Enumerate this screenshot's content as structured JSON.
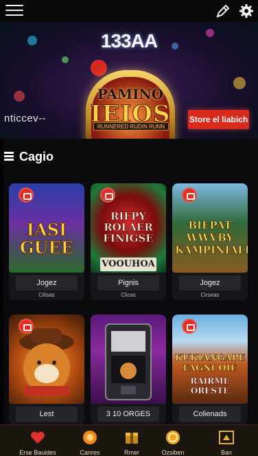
{
  "app": {
    "icons": {
      "menu": "hamburger-icon",
      "edit": "pencil-icon",
      "settings": "gear-icon"
    }
  },
  "banner": {
    "logo": "133AA",
    "title_line1": "PAMINO",
    "title_line2": "IEIOS",
    "tagline": "RUNNERED RUDIN RUNN",
    "left_text": "nticcev--",
    "cta_label": "Store el liabich",
    "colors": {
      "cta": "#d92a1e",
      "gold": "#f6d36b"
    }
  },
  "section": {
    "title": "Cagio",
    "icon": "list-icon"
  },
  "games": [
    {
      "art_title": "IASI GUEE",
      "art_sub": "",
      "name": "Jogez",
      "sub": "Cilisas"
    },
    {
      "art_title": "RIFPY ROLAER FINIGSE",
      "art_sub": "VOOUHOA",
      "name": "Pignis",
      "sub": "Clicas"
    },
    {
      "art_title": "BIEPAT WWVBY KAMPINIALE",
      "art_sub": "",
      "name": "Jogez",
      "sub": "Cirseas"
    },
    {
      "art_title": "",
      "art_sub": "",
      "name": "Lest",
      "sub": ""
    },
    {
      "art_title": "",
      "art_sub": "",
      "name": "3 10 ORGES",
      "sub": ""
    },
    {
      "art_title": "KUKIANGAPE FAGNCOIE",
      "art_sub": "RAIRME ORESTE",
      "name": "Colienads",
      "sub": ""
    }
  ],
  "bottom_nav": [
    {
      "label": "Erse Bauides",
      "icon": "heart-icon"
    },
    {
      "label": "Canres",
      "icon": "coin-icon"
    },
    {
      "label": "Rmer",
      "icon": "gift-icon"
    },
    {
      "label": "Ozsiben",
      "icon": "token-icon"
    },
    {
      "label": "Ban",
      "icon": "profile-icon"
    }
  ]
}
